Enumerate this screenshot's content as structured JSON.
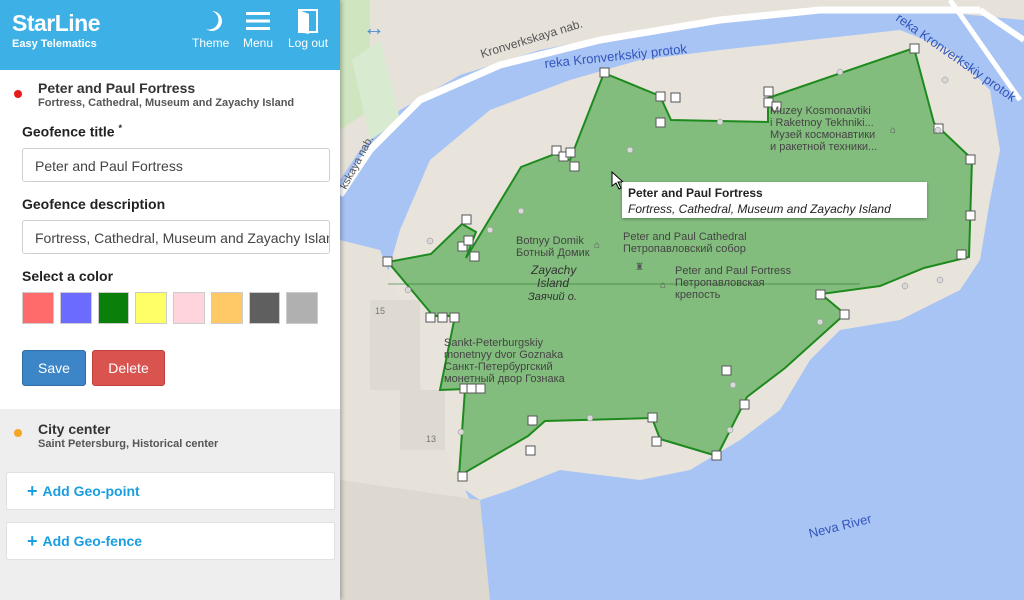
{
  "header": {
    "brand": "StarLine",
    "brand_sub": "Easy Telematics",
    "theme_label": "Theme",
    "menu_label": "Menu",
    "logout_label": "Log out"
  },
  "active_geofence": {
    "title": "Peter and Paul Fortress",
    "subtitle": "Fortress, Cathedral, Museum and Zayachy Island",
    "dot_color": "#e81a1a"
  },
  "form": {
    "title_label": "Geofence title",
    "title_required": "*",
    "title_value": "Peter and Paul Fortress",
    "desc_label": "Geofence description",
    "desc_value": "Fortress, Cathedral, Museum and Zayachy Island",
    "color_label": "Select a color",
    "colors": [
      "#ff6b6b",
      "#6b6bff",
      "#0a7f0a",
      "#ffff66",
      "#ffd4dc",
      "#ffc966",
      "#5f5f5f",
      "#b0b0b0"
    ],
    "save_label": "Save",
    "delete_label": "Delete"
  },
  "other_geofence": {
    "title": "City center",
    "subtitle": "Saint Petersburg, Historical center",
    "dot_color": "#f5a623"
  },
  "actions": {
    "add_point": "Add Geo-point",
    "add_fence": "Add Geo-fence",
    "plus": "+"
  },
  "map": {
    "labels": {
      "kronverkskaya": "Kronverkskaya nab.",
      "kronverkskaya_left": "kskaya nab.",
      "reka_kronverkskiy": "reka Kronverkskiy protok",
      "reka_kronverkskiy_right": "reka Kronverkskiy protok",
      "muzey_en1": "Muzey Kosmonavtiki",
      "muzey_en2": "i Raketnoy Tekhniki...",
      "muzey_ru1": "Музей космонавтики",
      "muzey_ru2": "и ракетной техники...",
      "botny_en": "Botnyy Domik",
      "botny_ru": "Ботный Домик",
      "cathedral_en": "Peter and Paul Cathedral",
      "cathedral_ru": "Петропавловский собор",
      "zayachy_en1": "Zayachy",
      "zayachy_en2": "Island",
      "zayachy_ru": "Заячий о.",
      "fortress_en": "Peter and Paul Fortress",
      "fortress_ru1": "Петропавловская",
      "fortress_ru2": "крепость",
      "mint_en1": "Sankt-Peterburgskiy",
      "mint_en2": "monetnyy dvor Goznaka",
      "mint_ru1": "Санкт-Петербургский",
      "mint_ru2": "монетный двор Гознака",
      "neva": "Neva River",
      "num15": "15",
      "num13": "13"
    },
    "tooltip_title": "Peter and Paul Fortress",
    "tooltip_sub": "Fortress, Cathedral, Museum and Zayachy Island",
    "fence_fill": "#3fa33f",
    "fence_stroke": "#1e8a1e",
    "water": "#a8c4f5",
    "land": "#e8e4dc"
  }
}
